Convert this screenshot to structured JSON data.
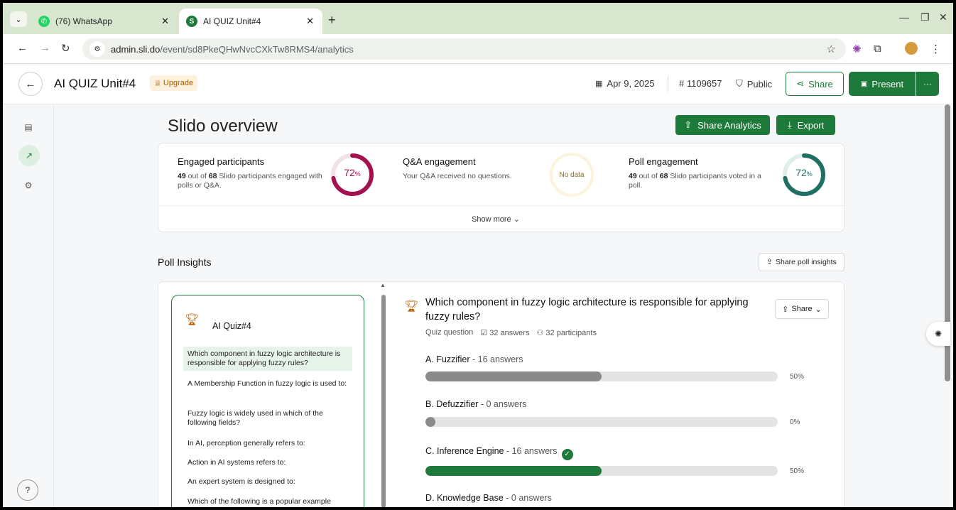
{
  "browser": {
    "tabs": [
      {
        "label": "(76) WhatsApp",
        "icon": "whatsapp-icon"
      },
      {
        "label": "AI QUIZ Unit#4",
        "icon": "slido-icon"
      }
    ],
    "url_domain": "admin.sli.do",
    "url_path": "/event/sd8PkeQHwNvcCXkTw8RMS4/analytics"
  },
  "header": {
    "title": "AI QUIZ Unit#4",
    "upgrade_label": "Upgrade",
    "date": "Apr 9, 2025",
    "event_code": "# 1109657",
    "visibility": "Public",
    "share_label": "Share",
    "present_label": "Present",
    "more_label": "···"
  },
  "overview": {
    "title": "Slido overview",
    "share_analytics_label": "Share Analytics",
    "export_label": "Export",
    "engaged": {
      "title": "Engaged participants",
      "count": "49",
      "mid": " out of ",
      "total": "68",
      "suffix": " Slido participants engaged with polls or Q&A.",
      "percent_value": "72",
      "percent_sign": "%",
      "fraction": 0.72,
      "color": "#a3124f"
    },
    "qa": {
      "title": "Q&A engagement",
      "desc": "Your Q&A received no questions.",
      "badge": "No data"
    },
    "poll": {
      "title": "Poll engagement",
      "count": "49",
      "mid": " out of ",
      "total": "68",
      "suffix": " Slido participants voted in a poll.",
      "percent_value": "72",
      "percent_sign": "%",
      "fraction": 0.72,
      "color": "#1f6f64"
    },
    "show_more_label": "Show more"
  },
  "poll_insights": {
    "title": "Poll Insights",
    "share_label": "Share poll insights",
    "quiz_name": "AI Quiz#4",
    "questions": [
      "Which component in fuzzy logic architecture is responsible for applying fuzzy rules?",
      "A Membership Function in fuzzy logic is used to:",
      "Fuzzy logic is widely used in which of the following fields?",
      "In AI, perception generally refers to:",
      "Action in AI systems refers to:",
      "An expert system is designed to:",
      "Which of the following is a popular example"
    ],
    "selected_question": {
      "title": "Which component in fuzzy logic architecture is responsible for applying fuzzy rules?",
      "type": "Quiz question",
      "answers_count": "32 answers",
      "participants_count": "32 participants",
      "share_label": "Share",
      "options": [
        {
          "label": "A. Fuzzifier",
          "count": " - 16 answers",
          "percent": "50%",
          "fraction": 0.5,
          "correct": false
        },
        {
          "label": "B. Defuzzifier",
          "count": " - 0 answers",
          "percent": "0%",
          "fraction": 0,
          "correct": false
        },
        {
          "label": "C. Inference Engine",
          "count": " - 16 answers",
          "percent": "50%",
          "fraction": 0.5,
          "correct": true
        },
        {
          "label": "D. Knowledge Base",
          "count": " - 0 answers",
          "percent": "",
          "fraction": 0,
          "correct": false
        }
      ]
    }
  },
  "colors": {
    "brand_green": "#1e7a3a",
    "bar_gray": "#8a8a8a",
    "engaged_ring": "#a3124f",
    "poll_ring": "#1f6f64"
  }
}
